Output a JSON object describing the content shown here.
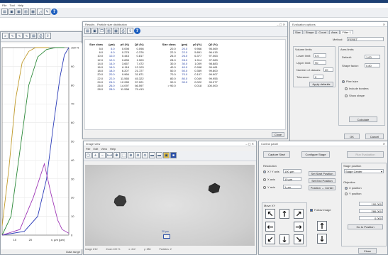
{
  "app": {
    "menu": [
      "File",
      "Tool",
      "Help"
    ],
    "toolbar_icons": [
      "open-icon",
      "save-icon",
      "chart-icon",
      "chart-icon",
      "grid-icon",
      "graph-icon",
      "settings-icon",
      "help-icon"
    ]
  },
  "chart_window": {
    "toolbar_icons": [
      "zoom-icon",
      "graph-icon",
      "graph-icon",
      "graph-icon",
      "table-icon",
      "print-icon",
      "export-icon"
    ],
    "y_ticks_right": [
      "100 %",
      "90",
      "80",
      "70",
      "60",
      "50",
      "40",
      "30",
      "20",
      "10",
      "0"
    ],
    "x_ticks": [
      "10",
      "20",
      "x, µm (µm)"
    ],
    "status": "Data range"
  },
  "chart_data": {
    "type": "line",
    "xlabel": "x, µm (µm)",
    "ylabel": "",
    "ylim": [
      0,
      100
    ],
    "xlim": [
      0,
      30
    ],
    "grid": true,
    "series": [
      {
        "color": "#c09a2a",
        "x": [
          0,
          3,
          6,
          9,
          12,
          15,
          18,
          21
        ],
        "y": [
          5,
          35,
          72,
          92,
          98,
          100,
          100,
          100
        ]
      },
      {
        "color": "#2d8a3a",
        "x": [
          0,
          4,
          8,
          12,
          16,
          20,
          24,
          28
        ],
        "y": [
          0,
          10,
          45,
          80,
          95,
          99,
          100,
          100
        ]
      },
      {
        "color": "#2a3bb8",
        "x": [
          0,
          10,
          16,
          20,
          23,
          26,
          28,
          30
        ],
        "y": [
          0,
          2,
          10,
          30,
          58,
          84,
          96,
          100
        ]
      },
      {
        "color": "#a03ab8",
        "x": [
          0,
          8,
          14,
          19,
          22,
          25,
          27,
          30
        ],
        "y": [
          0,
          3,
          20,
          38,
          22,
          8,
          3,
          1
        ]
      }
    ]
  },
  "table_window": {
    "title": "Results - Particle size distribution",
    "icons": [
      "open-icon",
      "save-icon",
      "copy-icon",
      "chart-icon",
      "table-icon",
      "print-icon",
      "export-icon",
      "help-icon"
    ],
    "headers": [
      "Size class",
      "(µm)",
      "p0 (%)",
      "Q0 (%)",
      "Size class",
      "(µm)",
      "p0 (%)",
      "Q0 (%)"
    ],
    "rows": [
      [
        "5.0",
        "5.0",
        "0.098",
        "0.098",
        "20.0",
        "20.0",
        "9.966",
        "95.069"
      ],
      [
        "6.0",
        "6.0",
        "0.278",
        "0.376",
        "22.0",
        "22.0",
        "5.891",
        "96.415"
      ],
      [
        "10.0",
        "10.0",
        "0.443",
        "0.817",
        "26.0",
        "26.0",
        "6.377",
        "97.063"
      ],
      [
        "12.0",
        "12.0",
        "0.835",
        "1.909",
        "28.0",
        "28.0",
        "1.914",
        "97.983"
      ],
      [
        "14.0",
        "14.0",
        "3.657",
        "7.472",
        "30.0",
        "30.0",
        "1.009",
        "98.883"
      ],
      [
        "16.0",
        "16.0",
        "6.118",
        "12.103",
        "40.0",
        "40.0",
        "0.998",
        "99.481"
      ],
      [
        "18.0",
        "18.0",
        "6.207",
        "21.727",
        "50.0",
        "50.0",
        "0.359",
        "99.800"
      ],
      [
        "20.0",
        "20.0",
        "9.966",
        "31.871",
        "70.0",
        "70.0",
        "0.107",
        "99.907"
      ],
      [
        "22.0",
        "22.0",
        "11.565",
        "45.322",
        "80.0",
        "80.0",
        "0.049",
        "99.955"
      ],
      [
        "24.0",
        "24.0",
        "12.283",
        "57.021",
        "90.0",
        "90.0",
        "0.022",
        "99.977"
      ],
      [
        "26.0",
        "26.0",
        "14.097",
        "66.597",
        "> 90.0",
        "",
        "0.018",
        "100.000"
      ],
      [
        "28.0",
        "28.0",
        "11.558",
        "79.413",
        "",
        "",
        "",
        ""
      ]
    ],
    "close_label": "Close"
  },
  "image_window": {
    "title": "Image view",
    "menu": [
      "File",
      "Edit",
      "View",
      "Help"
    ],
    "toolbar_icons": [
      "fit-icon",
      "zoom-in-icon",
      "zoom-out-icon",
      "measure-icon",
      "pan-icon",
      "select-icon",
      "zoom-in-icon",
      "zoom-out-icon",
      "zoom-reset-icon",
      "export-icon",
      "export-icon",
      "save-icon",
      "stop-icon"
    ],
    "marker_label": "20 µm",
    "status": [
      "Image 1/12",
      "Zoom 100 %",
      "x: 412",
      "y: 286",
      "Particles: 2"
    ]
  },
  "options_window": {
    "title": "Evaluation options",
    "tabs": [
      "Size",
      "Shape",
      "Count",
      "Area",
      "Filter 1"
    ],
    "method_label": "Method:",
    "method_value": "FERET",
    "fields": [
      {
        "label": "Lower limit:",
        "value": "5.0"
      },
      {
        "label": "Upper limit:",
        "value": "90"
      },
      {
        "label": "Number of classes:",
        "value": "20"
      },
      {
        "label": "Tolerance:",
        "value": "0"
      }
    ],
    "right_fields": [
      {
        "label": "Default:",
        "value": "1.00"
      },
      {
        "label": "Shape factor:",
        "value": "0.80"
      }
    ],
    "options": [
      "Pixel size",
      "Include borders",
      "Show shape"
    ],
    "apply_label": "Apply defaults",
    "calc_label": "Calculate",
    "ok_label": "OK",
    "cancel_label": "Cancel",
    "label_1": "Volume limits",
    "label_2": "Area limits"
  },
  "control_window": {
    "title": "Control panel",
    "top_buttons": [
      "Capture Start",
      "Configure Stage",
      "Run Evaluation"
    ],
    "resolution_label": "Resolution",
    "radio_labels": [
      "X / Y axis",
      "X axis",
      "Y axis"
    ],
    "radio_fields": [
      "100 µm",
      "10 µm",
      "1 µm"
    ],
    "mid_buttons": [
      "Set Start Position",
      "Set End Position",
      "Position ↔ Center"
    ],
    "move_label": "Move XY",
    "checkbox_label": "Follow image",
    "right_group_title": "Stage position",
    "right_select": "Stage Center",
    "right_group2": "Objective",
    "right_radios": [
      "X position",
      "Y position"
    ],
    "right_fields": [
      "190.000",
      "286.000",
      "0.000"
    ],
    "right_button": "Go to Position",
    "close_label": "Close"
  }
}
